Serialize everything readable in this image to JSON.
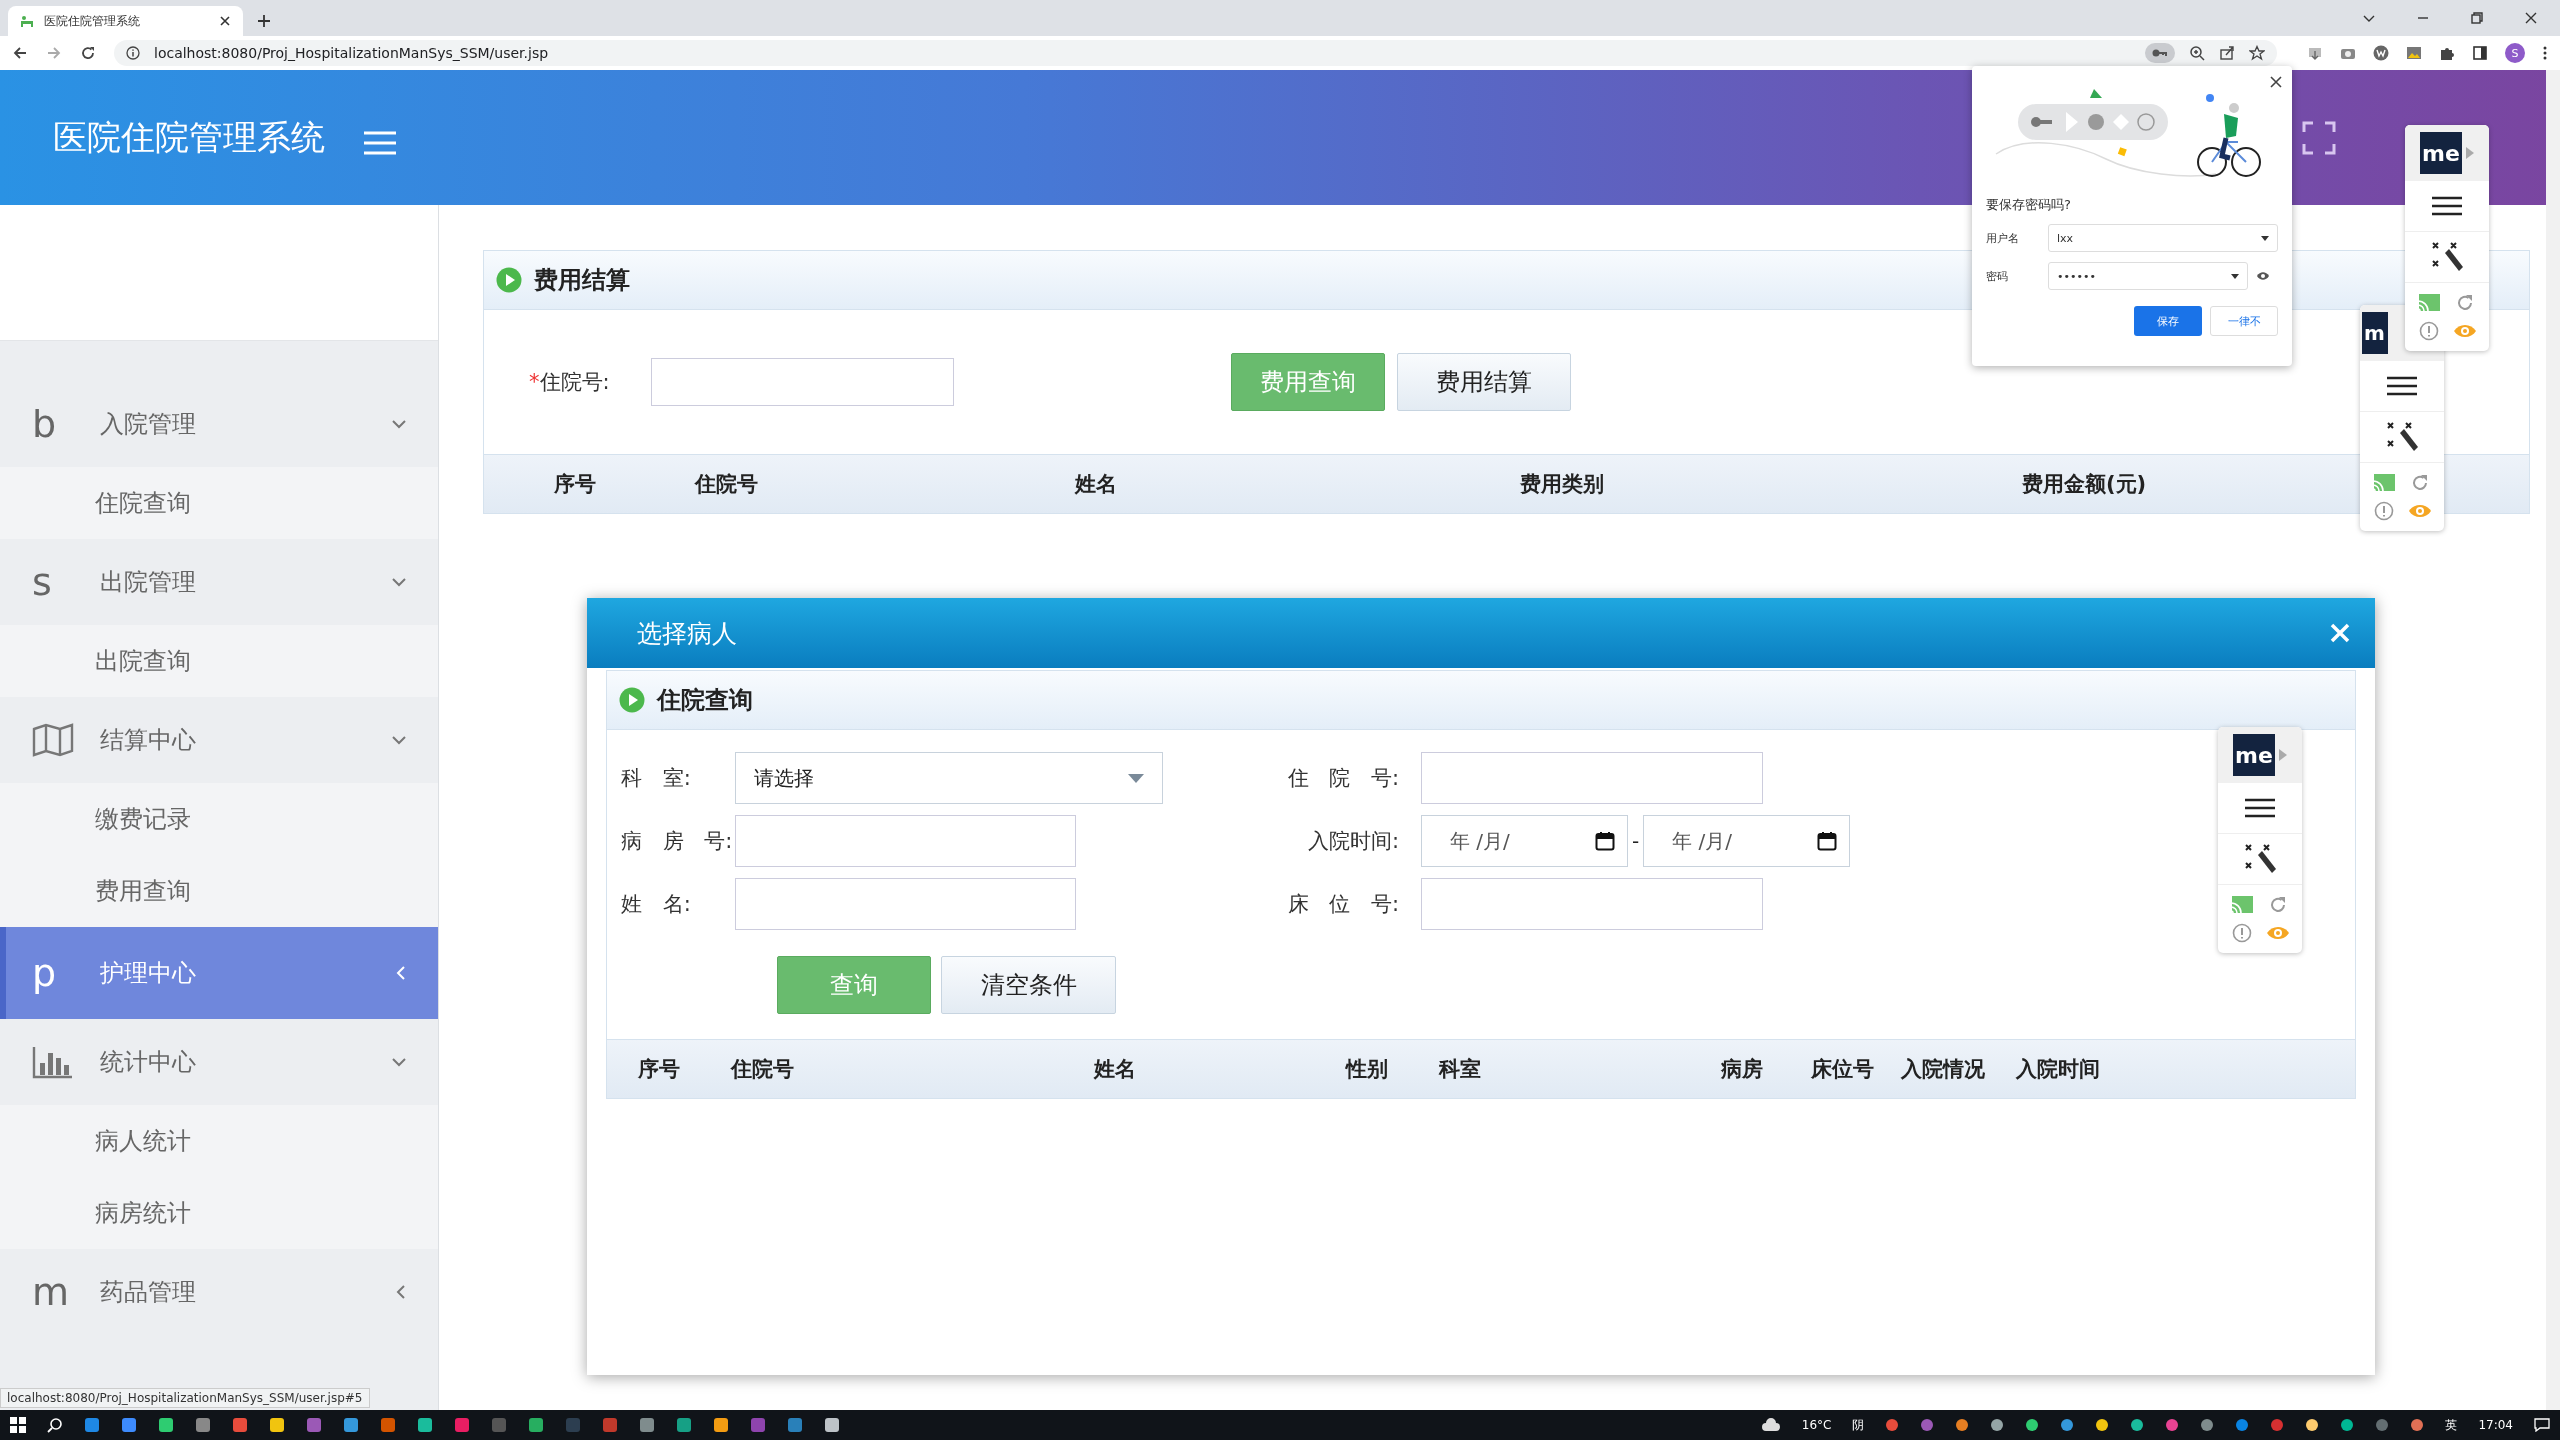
{
  "browser": {
    "tab_title": "医院住院管理系统",
    "url": "localhost:8080/Proj_HospitalizationManSys_SSM/user.jsp",
    "avatar": "S"
  },
  "header": {
    "title": "医院住院管理系统"
  },
  "sidebar": {
    "groups": [
      {
        "kind": "letter",
        "letter": "b",
        "label": "入院管理",
        "expanded": true,
        "selected": false,
        "children": [
          {
            "label": "住院查询"
          }
        ]
      },
      {
        "kind": "letter",
        "letter": "s",
        "label": "出院管理",
        "expanded": true,
        "selected": false,
        "children": [
          {
            "label": "出院查询"
          }
        ]
      },
      {
        "kind": "map",
        "label": "结算中心",
        "expanded": true,
        "selected": false,
        "children": [
          {
            "label": "缴费记录"
          },
          {
            "label": "费用查询"
          }
        ]
      },
      {
        "kind": "letter",
        "letter": "p",
        "label": "护理中心",
        "expanded": false,
        "selected": true
      },
      {
        "kind": "chart",
        "label": "统计中心",
        "expanded": true,
        "selected": false,
        "children": [
          {
            "label": "病人统计"
          },
          {
            "label": "病房统计"
          }
        ]
      },
      {
        "kind": "letter",
        "letter": "m",
        "label": "药品管理",
        "expanded": false,
        "selected": false
      }
    ]
  },
  "fee_panel": {
    "title": "费用结算",
    "required_mark": "*",
    "field_label": "住院号:",
    "buttons": [
      {
        "label": "费用查询",
        "kind": "primary"
      },
      {
        "label": "费用结算",
        "kind": "default"
      }
    ],
    "columns": [
      "序号",
      "住院号",
      "姓名",
      "费用类别",
      "费用金额(元)"
    ]
  },
  "dialog": {
    "title": "选择病人",
    "panel_title": "住院查询",
    "fields": [
      {
        "kind": "select",
        "label": "科 室:",
        "value": "请选择"
      },
      {
        "kind": "text",
        "label": "住 院 号:"
      },
      {
        "kind": "text",
        "label": "病 房 号:"
      },
      {
        "kind": "daterange",
        "label": "入院时间:",
        "from": {
          "placeholder": "年 /月/"
        },
        "separator": "-",
        "to": {
          "placeholder": "年 /月/"
        }
      },
      {
        "kind": "text",
        "label": "姓 名:"
      },
      {
        "kind": "text",
        "label": "床 位 号:"
      }
    ],
    "buttons": [
      {
        "label": "查询",
        "kind": "primary"
      },
      {
        "label": "清空条件",
        "kind": "default"
      }
    ],
    "columns": [
      "序号",
      "住院号",
      "姓名",
      "性别",
      "科室",
      "病房",
      "床位号",
      "入院情况",
      "入院时间"
    ]
  },
  "password_popup": {
    "title": "要保存密码吗?",
    "username_label": "用户名",
    "username": "lxx",
    "password_label": "密码",
    "password": "••••••",
    "buttons": [
      {
        "label": "保存",
        "kind": "primary"
      },
      {
        "label": "一律不",
        "kind": "default"
      }
    ]
  },
  "extension_widgets": [
    {
      "logo": "me",
      "kind": "header"
    },
    {
      "logo": "m",
      "kind": "behind"
    },
    {
      "logo": "me",
      "kind": "dialog"
    }
  ],
  "status_url": "localhost:8080/Proj_HospitalizationManSys_SSM/user.jsp#5",
  "taskbar": {
    "temperature": "16°C",
    "weather": "阴",
    "ime": "英",
    "time": "17:04"
  }
}
